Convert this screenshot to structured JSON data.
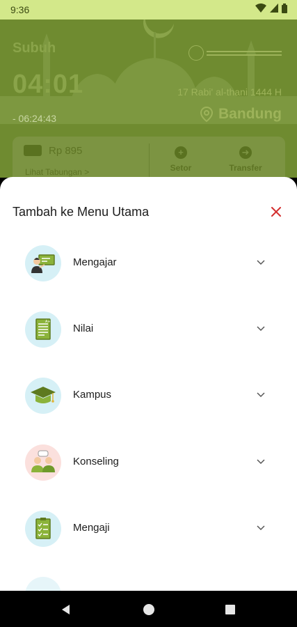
{
  "status_bar": {
    "time": "9:36"
  },
  "header": {
    "prayer_name": "Subuh",
    "prayer_time": "04:01",
    "countdown": "- 06:24:43",
    "hijri_date": "17 Rabi' al-thani 1444 H",
    "location": "Bandung"
  },
  "wallet": {
    "balance": "Rp 895",
    "link_label": "Lihat Tabungan  >",
    "actions": [
      {
        "label": "Setor",
        "icon": "plus-circle-icon"
      },
      {
        "label": "Transfer",
        "icon": "arrow-right-circle-icon"
      }
    ]
  },
  "sheet": {
    "title": "Tambah ke Menu Utama",
    "close_icon": "close-icon",
    "items": [
      {
        "label": "Mengajar",
        "icon": "teacher-board-icon",
        "bg": "#d6f0f6"
      },
      {
        "label": "Nilai",
        "icon": "grade-sheet-icon",
        "bg": "#d6f0f6"
      },
      {
        "label": "Kampus",
        "icon": "graduation-cap-icon",
        "bg": "#d6f0f6"
      },
      {
        "label": "Konseling",
        "icon": "counseling-people-icon",
        "bg": "#fbe0dd"
      },
      {
        "label": "Mengaji",
        "icon": "checklist-icon",
        "bg": "#d6f0f6"
      }
    ]
  },
  "colors": {
    "accent_green": "#8bb33a",
    "header_green": "#6f8b30",
    "close_red": "#d32f2f"
  },
  "nav": [
    "back-icon",
    "home-icon",
    "recents-icon"
  ]
}
